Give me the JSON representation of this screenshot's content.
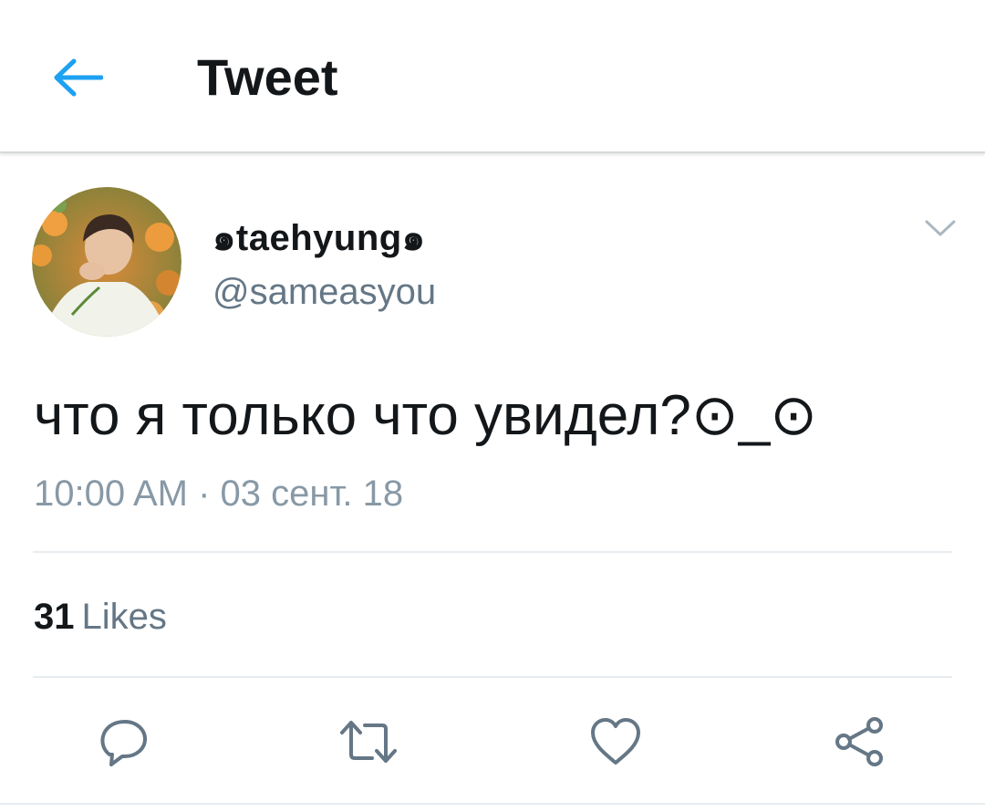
{
  "header": {
    "title": "Tweet",
    "back_icon": "arrow-left-icon"
  },
  "tweet": {
    "display_name": "๑taehyung๑",
    "username": "@sameasyou",
    "text": "что я только что увидел?⊙_⊙",
    "timestamp": "10:00 AM · 03 сент. 18",
    "menu_icon": "chevron-down-icon"
  },
  "stats": {
    "likes_count": "31",
    "likes_label": "Likes"
  },
  "actions": [
    {
      "name": "reply",
      "icon": "reply-icon"
    },
    {
      "name": "retweet",
      "icon": "retweet-icon"
    },
    {
      "name": "like",
      "icon": "heart-icon"
    },
    {
      "name": "share",
      "icon": "share-icon"
    }
  ],
  "colors": {
    "accent": "#1da1f2",
    "text_primary": "#14171a",
    "text_secondary": "#657786",
    "icon_gray": "#657786",
    "divider": "#e6ecf0"
  }
}
